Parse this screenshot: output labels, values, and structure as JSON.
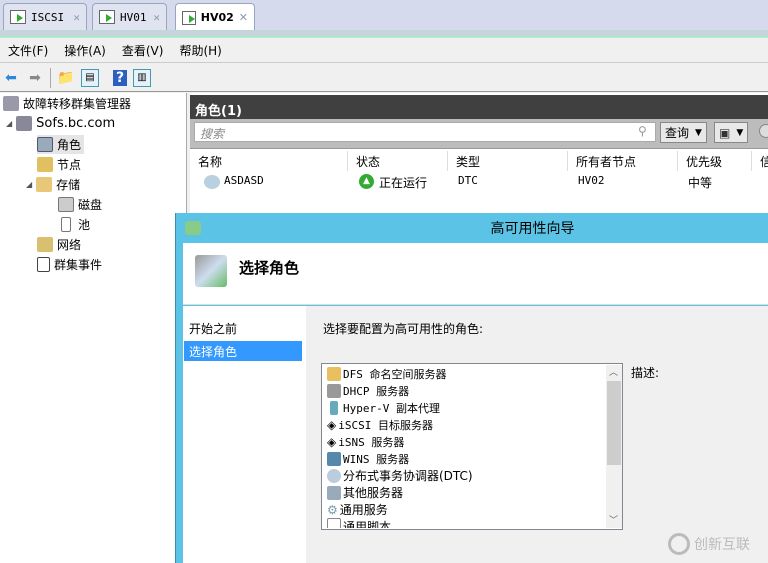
{
  "tabs": [
    {
      "label": "ISCSI",
      "active": false
    },
    {
      "label": "HV01",
      "active": false
    },
    {
      "label": "HV02",
      "active": true
    }
  ],
  "menu": [
    "文件(F)",
    "操作(A)",
    "查看(V)",
    "帮助(H)"
  ],
  "tree": {
    "root": "故障转移群集管理器",
    "cluster": "Sofs.bc.com",
    "items": {
      "roles": "角色",
      "nodes": "节点",
      "storage": "存储",
      "disks": "磁盘",
      "pools": "池",
      "networks": "网络",
      "events": "群集事件"
    }
  },
  "pane": {
    "title": "角色(1)",
    "search_placeholder": "搜索",
    "query_label": "查询",
    "columns": [
      "名称",
      "状态",
      "类型",
      "所有者节点",
      "优先级",
      "信"
    ],
    "rows": [
      {
        "name": "ASDASD",
        "status": "正在运行",
        "type": "DTC",
        "owner": "HV02",
        "priority": "中等"
      }
    ]
  },
  "dialog": {
    "title": "高可用性向导",
    "header": "选择角色",
    "nav": [
      {
        "label": "开始之前",
        "selected": false
      },
      {
        "label": "选择角色",
        "selected": true
      }
    ],
    "prompt": "选择要配置为高可用性的角色:",
    "description_label": "描述:",
    "roles": [
      "DFS 命名空间服务器",
      "DHCP 服务器",
      "Hyper-V 副本代理",
      "iSCSI 目标服务器",
      "iSNS 服务器",
      "WINS 服务器",
      "分布式事务协调器(DTC)",
      "其他服务器",
      "通用服务",
      "通用脚本"
    ]
  },
  "watermark": "创新互联",
  "colors": {
    "dialog_title": "#5bc4e6",
    "selection": "#3399ff",
    "pane_header": "#404040"
  }
}
